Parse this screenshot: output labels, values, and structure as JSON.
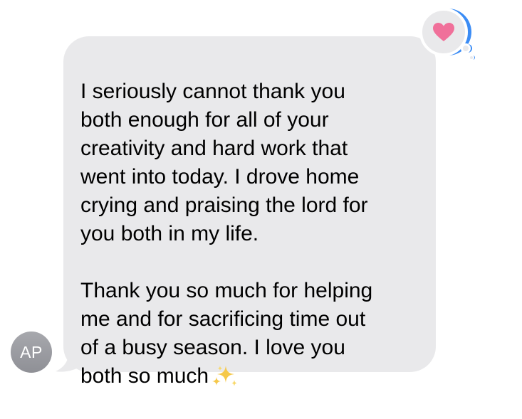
{
  "avatar": {
    "initials": "AP"
  },
  "message": {
    "text": "I seriously cannot thank you\nboth enough for all of your\ncreativity and hard work that\nwent into today. I drove home\ncrying and praising the lord for\nyou both in my life.\n\nThank you so much for helping\nme and for sacrificing time out\nof a busy season. I love you\nboth so much",
    "trailing_icon": "sparkles-icon"
  },
  "tapback": {
    "reaction": "heart-icon",
    "reaction_color": "#f0709a",
    "ring_color": "#3b8cf5"
  },
  "colors": {
    "bubble_background": "#e9e9eb",
    "avatar_background": "#999a9f",
    "text": "#000000"
  }
}
